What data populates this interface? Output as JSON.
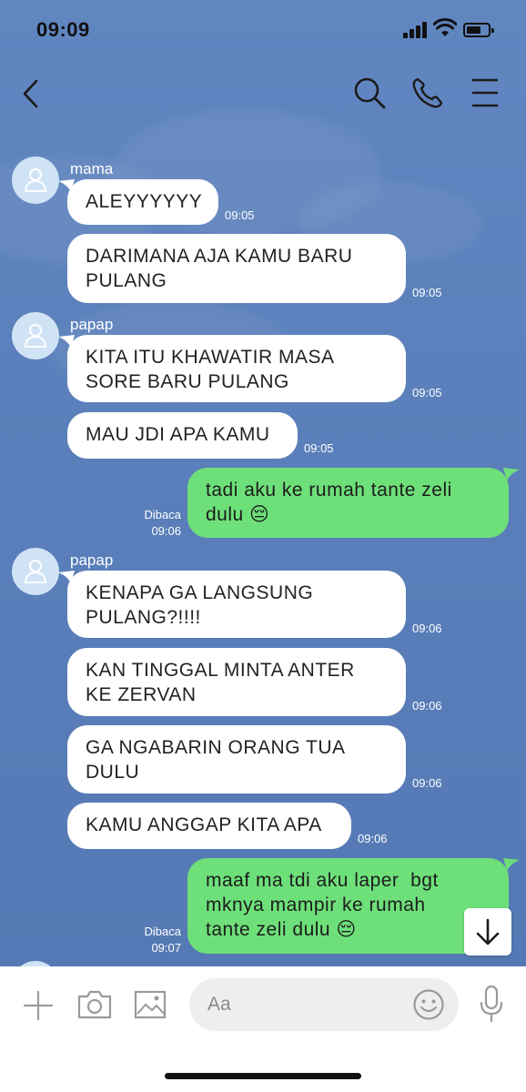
{
  "status_bar": {
    "time": "09:09"
  },
  "input": {
    "placeholder": "Aa"
  },
  "messages": [
    {
      "type": "in",
      "sender": "mama",
      "text": "ALEYYYYYY",
      "time": "09:05"
    },
    {
      "type": "in",
      "sender": "",
      "text": "DARIMANA AJA KAMU BARU\nPULANG",
      "time": "09:05"
    },
    {
      "type": "in",
      "sender": "papap",
      "text": "KITA ITU KHAWATIR MASA\nSORE BARU PULANG",
      "time": "09:05"
    },
    {
      "type": "in",
      "sender": "",
      "text": "MAU JDI APA KAMU",
      "time": "09:05"
    },
    {
      "type": "out",
      "read": "Dibaca",
      "text": "tadi aku ke rumah tante zeli\ndulu 😔",
      "time": "09:06"
    },
    {
      "type": "in",
      "sender": "papap",
      "text": "KENAPA GA LANGSUNG\nPULANG?!!!!",
      "time": "09:06"
    },
    {
      "type": "in",
      "sender": "",
      "text": "KAN TINGGAL MINTA ANTER\nKE ZERVAN",
      "time": "09:06"
    },
    {
      "type": "in",
      "sender": "",
      "text": "GA NGABARIN ORANG TUA\nDULU",
      "time": "09:06"
    },
    {
      "type": "in",
      "sender": "",
      "text": "KAMU ANGGAP KITA APA",
      "time": "09:06"
    },
    {
      "type": "out",
      "read": "Dibaca",
      "text": "maaf ma tdi aku laper  bgt\nmknya mampir ke rumah\ntante zeli dulu 😔",
      "time": "09:07"
    }
  ],
  "icons": [
    "back-icon",
    "search-icon",
    "phone-icon",
    "menu-icon",
    "plus-icon",
    "camera-icon",
    "image-icon",
    "emoji-icon",
    "microphone-icon",
    "arrow-down-icon",
    "signal-icon",
    "wifi-icon",
    "battery-icon",
    "user-icon"
  ]
}
